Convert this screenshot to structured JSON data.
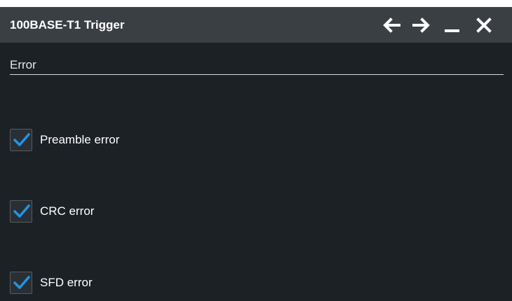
{
  "dialog": {
    "title": "100BASE-T1 Trigger",
    "buttons": {
      "back_icon": "arrow-left-icon",
      "forward_icon": "arrow-right-icon",
      "minimize_icon": "minimize-icon",
      "close_icon": "close-icon"
    }
  },
  "section": {
    "label": "Error"
  },
  "checkboxes": [
    {
      "label": "Preamble error",
      "checked": true
    },
    {
      "label": "CRC error",
      "checked": true
    },
    {
      "label": "SFD error",
      "checked": true
    }
  ],
  "colors": {
    "check_accent": "#1e96e6",
    "titlebar": "#3a3f44",
    "background": "#1c2126"
  }
}
